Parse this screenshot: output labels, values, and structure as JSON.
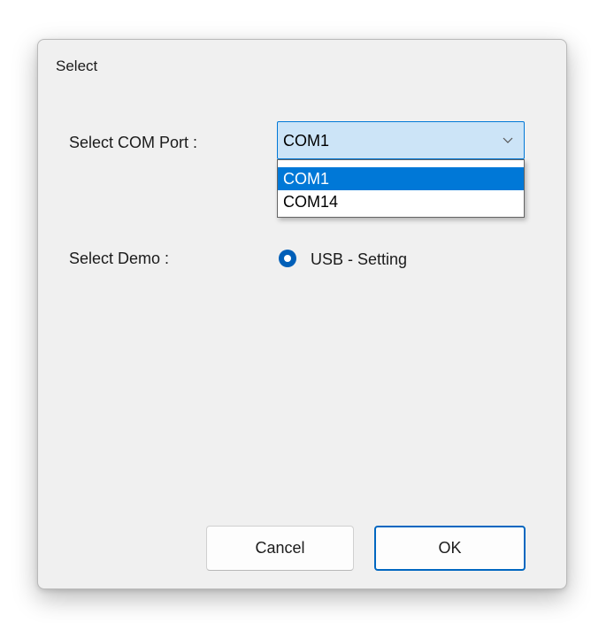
{
  "dialog": {
    "title": "Select",
    "com_port_label": "Select COM Port :",
    "demo_label": "Select Demo :"
  },
  "com_port": {
    "selected_value": "COM1",
    "options": [
      "COM1",
      "COM14"
    ],
    "highlighted_option": "COM1"
  },
  "demo": {
    "option_label": "USB - Setting",
    "selected": true
  },
  "buttons": {
    "cancel_label": "Cancel",
    "ok_label": "OK"
  },
  "colors": {
    "accent": "#0078d7",
    "combo_background": "#cce4f7",
    "dialog_background": "#f0f0f0",
    "radio_fill": "#005fb8"
  },
  "icons": {
    "combo_arrow": "chevron-down-icon"
  }
}
